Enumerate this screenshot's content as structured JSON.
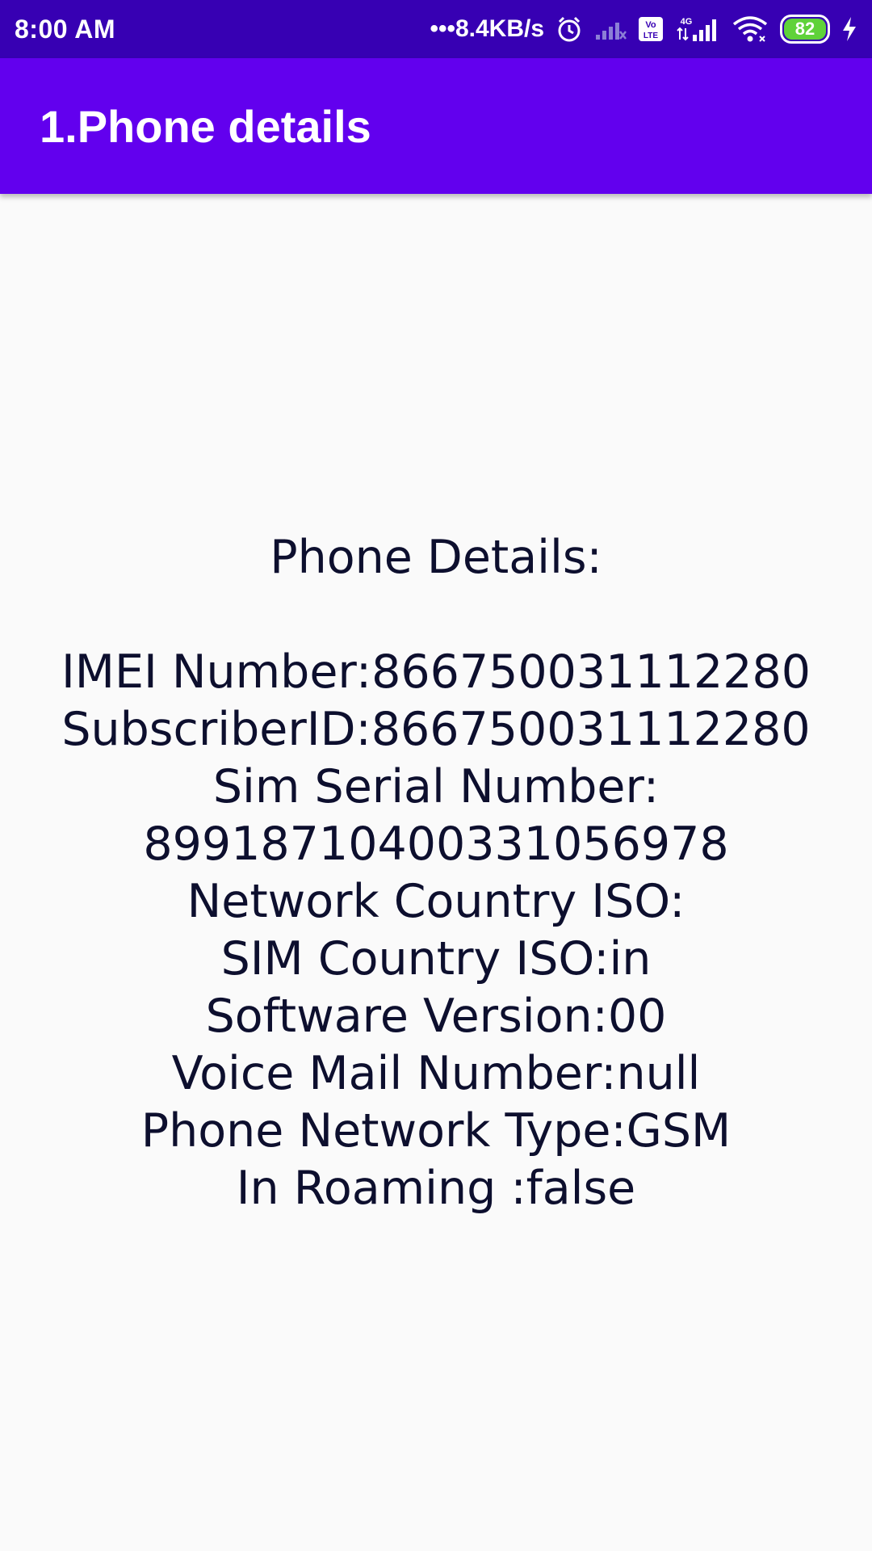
{
  "status_bar": {
    "time": "8:00 AM",
    "network_speed": "•••8.4KB/s",
    "network_type": "4G",
    "volte": "Vo LTE",
    "battery": "82",
    "icons": [
      "alarm-icon",
      "signal-weak-icon",
      "volte-icon",
      "signal-4g-icon",
      "wifi-icon",
      "battery-icon",
      "charging-icon"
    ]
  },
  "app_bar": {
    "title": "1.Phone details"
  },
  "details": {
    "heading": "Phone Details:",
    "lines": [
      "IMEI Number:866750031112280",
      "SubscriberID:866750031112280",
      "Sim Serial Number:",
      "89918710400331056978",
      "Network Country ISO:",
      "SIM Country ISO:in",
      "Software Version:00",
      "Voice Mail Number:null",
      "Phone Network Type:GSM",
      "In Roaming :false"
    ]
  },
  "colors": {
    "status_bar": "#3700b3",
    "app_bar": "#6200ee",
    "background": "#fafafa",
    "text": "#0d0f2e",
    "battery_fill": "#5fd23a"
  }
}
